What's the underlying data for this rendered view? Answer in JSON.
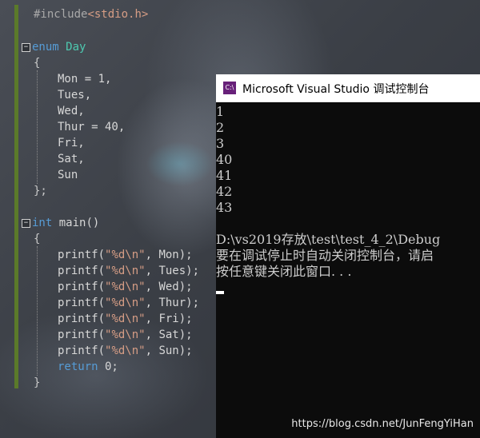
{
  "editor": {
    "include_directive": "#include",
    "include_file": "<stdio.h>",
    "enum_keyword": "enum",
    "enum_name": "Day",
    "open_brace": "{",
    "close_brace_semicolon": "};",
    "close_brace": "}",
    "enum_members": [
      "Mon = 1,",
      "Tues,",
      "Wed,",
      "Thur = 40,",
      "Fri,",
      "Sat,",
      "Sun"
    ],
    "int_keyword": "int",
    "main_signature": " main()",
    "printf_lines": [
      {
        "fn": "printf(",
        "fmt": "\"%d\\n\"",
        "arg": ", Mon);"
      },
      {
        "fn": "printf(",
        "fmt": "\"%d\\n\"",
        "arg": ", Tues);"
      },
      {
        "fn": "printf(",
        "fmt": "\"%d\\n\"",
        "arg": ", Wed);"
      },
      {
        "fn": "printf(",
        "fmt": "\"%d\\n\"",
        "arg": ", Thur);"
      },
      {
        "fn": "printf(",
        "fmt": "\"%d\\n\"",
        "arg": ", Fri);"
      },
      {
        "fn": "printf(",
        "fmt": "\"%d\\n\"",
        "arg": ", Sat);"
      },
      {
        "fn": "printf(",
        "fmt": "\"%d\\n\"",
        "arg": ", Sun);"
      }
    ],
    "return_keyword": "return",
    "return_value": " 0;",
    "fold_symbol": "−"
  },
  "console": {
    "title": "Microsoft Visual Studio 调试控制台",
    "icon_text": "C:\\",
    "output": [
      "1",
      "2",
      "3",
      "40",
      "41",
      "42",
      "43"
    ],
    "message_lines": [
      "D:\\vs2019存放\\test\\test_4_2\\Debug",
      "要在调试停止时自动关闭控制台，请启",
      "按任意键关闭此窗口. . ."
    ]
  },
  "watermark": "https://blog.csdn.net/JunFengYiHan",
  "colors": {
    "keyword": "#569cd6",
    "type": "#4ec9b0",
    "string": "#d69d85",
    "gutter": "#5b7a2a",
    "console_bg": "#0c0c0c"
  }
}
